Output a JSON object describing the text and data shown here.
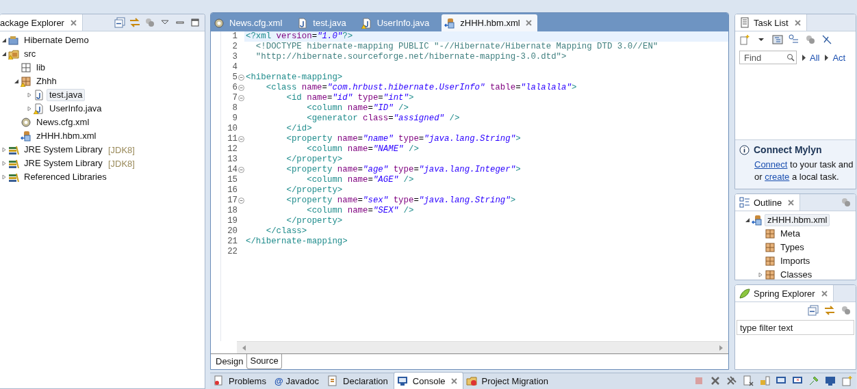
{
  "package_explorer": {
    "title": "ackage Explorer",
    "tree": [
      {
        "label": "Hibernate Demo",
        "kind": "project",
        "warning": false,
        "selected": false,
        "expanded": true,
        "children": [
          {
            "label": "src",
            "kind": "source-folder",
            "warning": true,
            "selected": false,
            "expanded": true,
            "children": [
              {
                "label": "lib",
                "kind": "empty-package",
                "warning": false,
                "selected": false
              },
              {
                "label": "Zhhh",
                "kind": "package",
                "warning": true,
                "selected": false,
                "expanded": true,
                "children": [
                  {
                    "label": "test.java",
                    "kind": "java-file",
                    "warning": false,
                    "selected": true,
                    "expanded": false
                  },
                  {
                    "label": "UserInfo.java",
                    "kind": "java-file",
                    "warning": true,
                    "selected": false,
                    "expanded": false
                  }
                ]
              },
              {
                "label": "News.cfg.xml",
                "kind": "config-file",
                "warning": false,
                "selected": false
              },
              {
                "label": "zHHH.hbm.xml",
                "kind": "mapping-file",
                "warning": false,
                "selected": false
              }
            ]
          },
          {
            "label": "JRE System Library",
            "decoration": "[JDK8]",
            "kind": "library",
            "warning": false,
            "selected": false,
            "expanded": false
          },
          {
            "label": "JRE System Library",
            "decoration": "[JDK8]",
            "kind": "library",
            "warning": false,
            "selected": false,
            "expanded": false
          },
          {
            "label": "Referenced Libraries",
            "kind": "library",
            "warning": false,
            "selected": false,
            "expanded": false
          }
        ]
      }
    ]
  },
  "editor": {
    "tabs": [
      {
        "label": "News.cfg.xml",
        "kind": "config-file",
        "warning": false,
        "selected": false
      },
      {
        "label": "test.java",
        "kind": "java-file",
        "warning": false,
        "selected": false
      },
      {
        "label": "UserInfo.java",
        "kind": "java-file",
        "warning": true,
        "selected": false
      },
      {
        "label": "zHHH.hbm.xml",
        "kind": "mapping-file",
        "warning": false,
        "selected": true
      }
    ],
    "lines": [
      {
        "number": "1",
        "fold": false,
        "current": true,
        "tokens": [
          {
            "kind": "tag",
            "text": "<?xml"
          },
          {
            "kind": "attr",
            "text": " version"
          },
          {
            "kind": "punct",
            "text": "="
          },
          {
            "kind": "value",
            "text": "\"1.0\""
          },
          {
            "kind": "tag",
            "text": "?>"
          }
        ]
      },
      {
        "number": "2",
        "fold": false,
        "current": false,
        "tokens": [
          {
            "kind": "doctype",
            "text": "  <!DOCTYPE hibernate-mapping PUBLIC \"-//Hibernate/Hibernate Mapping DTD 3.0//EN\""
          }
        ]
      },
      {
        "number": "3",
        "fold": false,
        "current": false,
        "tokens": [
          {
            "kind": "doctype",
            "text": "  \"http://hibernate.sourceforge.net/hibernate-mapping-3.0.dtd\">"
          }
        ]
      },
      {
        "number": "4",
        "fold": false,
        "current": false
      },
      {
        "number": "5",
        "fold": true,
        "current": false,
        "tokens": [
          {
            "kind": "tag",
            "text": "<hibernate-mapping>"
          }
        ]
      },
      {
        "number": "6",
        "fold": true,
        "current": false,
        "tokens": [
          {
            "kind": "tag",
            "text": "    <class"
          },
          {
            "kind": "attr",
            "text": " name"
          },
          {
            "kind": "punct",
            "text": "="
          },
          {
            "kind": "value",
            "text": "\"com.hrbust.hibernate.UserInfo\""
          },
          {
            "kind": "attr",
            "text": " table"
          },
          {
            "kind": "punct",
            "text": "="
          },
          {
            "kind": "value",
            "text": "\"lalalala\""
          },
          {
            "kind": "tag",
            "text": ">"
          }
        ]
      },
      {
        "number": "7",
        "fold": true,
        "current": false,
        "tokens": [
          {
            "kind": "tag",
            "text": "        <id"
          },
          {
            "kind": "attr",
            "text": " name"
          },
          {
            "kind": "punct",
            "text": "="
          },
          {
            "kind": "value",
            "text": "\"id\""
          },
          {
            "kind": "attr",
            "text": " type"
          },
          {
            "kind": "punct",
            "text": "="
          },
          {
            "kind": "value",
            "text": "\"int\""
          },
          {
            "kind": "tag",
            "text": ">"
          }
        ]
      },
      {
        "number": "8",
        "fold": false,
        "current": false,
        "tokens": [
          {
            "kind": "tag",
            "text": "            <column"
          },
          {
            "kind": "attr",
            "text": " name"
          },
          {
            "kind": "punct",
            "text": "="
          },
          {
            "kind": "value",
            "text": "\"ID\""
          },
          {
            "kind": "tag",
            "text": " />"
          }
        ]
      },
      {
        "number": "9",
        "fold": false,
        "current": false,
        "tokens": [
          {
            "kind": "tag",
            "text": "            <generator"
          },
          {
            "kind": "attr",
            "text": " class"
          },
          {
            "kind": "punct",
            "text": "="
          },
          {
            "kind": "value",
            "text": "\"assigned\""
          },
          {
            "kind": "tag",
            "text": " />"
          }
        ]
      },
      {
        "number": "10",
        "fold": false,
        "current": false,
        "tokens": [
          {
            "kind": "tag",
            "text": "        </id>"
          }
        ]
      },
      {
        "number": "11",
        "fold": true,
        "current": false,
        "tokens": [
          {
            "kind": "tag",
            "text": "        <property"
          },
          {
            "kind": "attr",
            "text": " name"
          },
          {
            "kind": "punct",
            "text": "="
          },
          {
            "kind": "value",
            "text": "\"name\""
          },
          {
            "kind": "attr",
            "text": " type"
          },
          {
            "kind": "punct",
            "text": "="
          },
          {
            "kind": "value",
            "text": "\"java.lang.String\""
          },
          {
            "kind": "tag",
            "text": ">"
          }
        ]
      },
      {
        "number": "12",
        "fold": false,
        "current": false,
        "tokens": [
          {
            "kind": "tag",
            "text": "            <column"
          },
          {
            "kind": "attr",
            "text": " name"
          },
          {
            "kind": "punct",
            "text": "="
          },
          {
            "kind": "value",
            "text": "\"NAME\""
          },
          {
            "kind": "tag",
            "text": " />"
          }
        ]
      },
      {
        "number": "13",
        "fold": false,
        "current": false,
        "tokens": [
          {
            "kind": "tag",
            "text": "        </property>"
          }
        ]
      },
      {
        "number": "14",
        "fold": true,
        "current": false,
        "tokens": [
          {
            "kind": "tag",
            "text": "        <property"
          },
          {
            "kind": "attr",
            "text": " name"
          },
          {
            "kind": "punct",
            "text": "="
          },
          {
            "kind": "value",
            "text": "\"age\""
          },
          {
            "kind": "attr",
            "text": " type"
          },
          {
            "kind": "punct",
            "text": "="
          },
          {
            "kind": "value",
            "text": "\"java.lang.Integer\""
          },
          {
            "kind": "tag",
            "text": ">"
          }
        ]
      },
      {
        "number": "15",
        "fold": false,
        "current": false,
        "tokens": [
          {
            "kind": "tag",
            "text": "            <column"
          },
          {
            "kind": "attr",
            "text": " name"
          },
          {
            "kind": "punct",
            "text": "="
          },
          {
            "kind": "value",
            "text": "\"AGE\""
          },
          {
            "kind": "tag",
            "text": " />"
          }
        ]
      },
      {
        "number": "16",
        "fold": false,
        "current": false,
        "tokens": [
          {
            "kind": "tag",
            "text": "        </property>"
          }
        ]
      },
      {
        "number": "17",
        "fold": true,
        "current": false,
        "tokens": [
          {
            "kind": "tag",
            "text": "        <property"
          },
          {
            "kind": "attr",
            "text": " name"
          },
          {
            "kind": "punct",
            "text": "="
          },
          {
            "kind": "value",
            "text": "\"sex\""
          },
          {
            "kind": "attr",
            "text": " type"
          },
          {
            "kind": "punct",
            "text": "="
          },
          {
            "kind": "value",
            "text": "\"java.lang.String\""
          },
          {
            "kind": "tag",
            "text": ">"
          }
        ]
      },
      {
        "number": "18",
        "fold": false,
        "current": false,
        "tokens": [
          {
            "kind": "tag",
            "text": "            <column"
          },
          {
            "kind": "attr",
            "text": " name"
          },
          {
            "kind": "punct",
            "text": "="
          },
          {
            "kind": "value",
            "text": "\"SEX\""
          },
          {
            "kind": "tag",
            "text": " />"
          }
        ]
      },
      {
        "number": "19",
        "fold": false,
        "current": false,
        "tokens": [
          {
            "kind": "tag",
            "text": "        </property>"
          }
        ]
      },
      {
        "number": "20",
        "fold": false,
        "current": false,
        "tokens": [
          {
            "kind": "tag",
            "text": "    </class>"
          }
        ]
      },
      {
        "number": "21",
        "fold": false,
        "current": false,
        "tokens": [
          {
            "kind": "tag",
            "text": "</hibernate-mapping>"
          }
        ]
      },
      {
        "number": "22",
        "fold": false,
        "current": false
      }
    ],
    "modes": [
      {
        "label": "Design",
        "selected": false
      },
      {
        "label": "Source",
        "selected": true
      }
    ]
  },
  "task_list": {
    "title": "Task List",
    "find_placeholder": "Find",
    "filters": [
      "All",
      "Act"
    ],
    "mylyn": {
      "title": "Connect Mylyn",
      "lines": [
        {
          "link": "Connect",
          "after": " to your task and"
        },
        {
          "before": "or ",
          "link": "create",
          "after": " a local task."
        }
      ]
    }
  },
  "outline": {
    "title": "Outline",
    "tree": [
      {
        "label": "zHHH.hbm.xml",
        "kind": "mapping-file",
        "selected": true,
        "expanded": true,
        "children": [
          {
            "label": "Meta",
            "kind": "package",
            "selected": false
          },
          {
            "label": "Types",
            "kind": "package",
            "selected": false
          },
          {
            "label": "Imports",
            "kind": "package",
            "selected": false
          },
          {
            "label": "Classes",
            "kind": "package",
            "selected": false,
            "expanded": false
          }
        ]
      }
    ]
  },
  "spring_explorer": {
    "title": "Spring Explorer",
    "filter_placeholder": "type filter text"
  },
  "bottom_panel": {
    "tabs": [
      {
        "label": "Problems",
        "kind": "problems",
        "selected": false
      },
      {
        "label": "Javadoc",
        "kind": "glyph",
        "glyph": "@",
        "selected": false
      },
      {
        "label": "Declaration",
        "kind": "declaration",
        "selected": false
      },
      {
        "label": "Console",
        "kind": "console",
        "selected": true
      },
      {
        "label": "Project Migration",
        "kind": "migration",
        "selected": false
      }
    ]
  }
}
